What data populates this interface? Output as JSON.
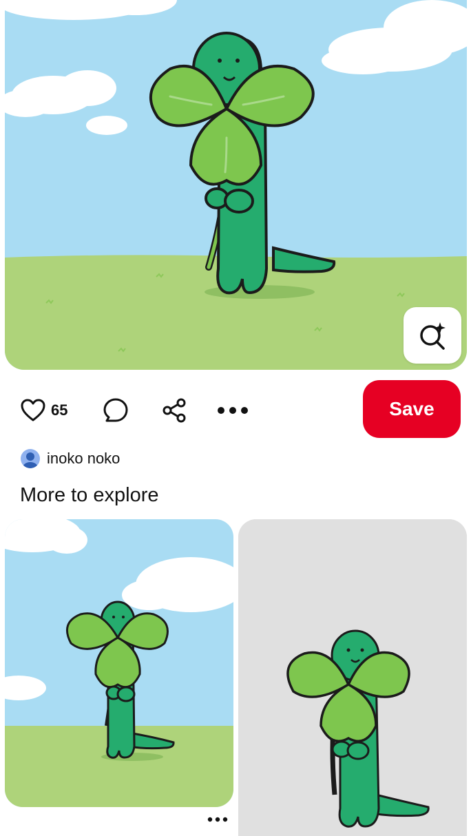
{
  "pin": {
    "image_alt": "Green clover creature holding a four-leaf clover on grass under a blue sky",
    "lens_icon": "visual-search-sparkle-icon"
  },
  "actions": {
    "like_icon": "heart-outline-icon",
    "like_count": "65",
    "comment_icon": "comment-bubble-icon",
    "share_icon": "share-icon",
    "more_icon": "more-horizontal-icon",
    "save_label": "Save"
  },
  "author": {
    "name": "inoko noko",
    "avatar_icon": "default-avatar-icon"
  },
  "explore": {
    "title": "More to explore",
    "items": [
      {
        "kind": "image",
        "alt": "Clover creature on grassy field"
      },
      {
        "kind": "image",
        "alt": "Clover creature on grey background"
      }
    ]
  },
  "colors": {
    "save_button": "#e60023",
    "sky": "#a9dcf3",
    "grass": "#aed37a",
    "creature": "#25ac6e",
    "leaf": "#7ec64e",
    "card_bg": "#e0e0e0"
  }
}
